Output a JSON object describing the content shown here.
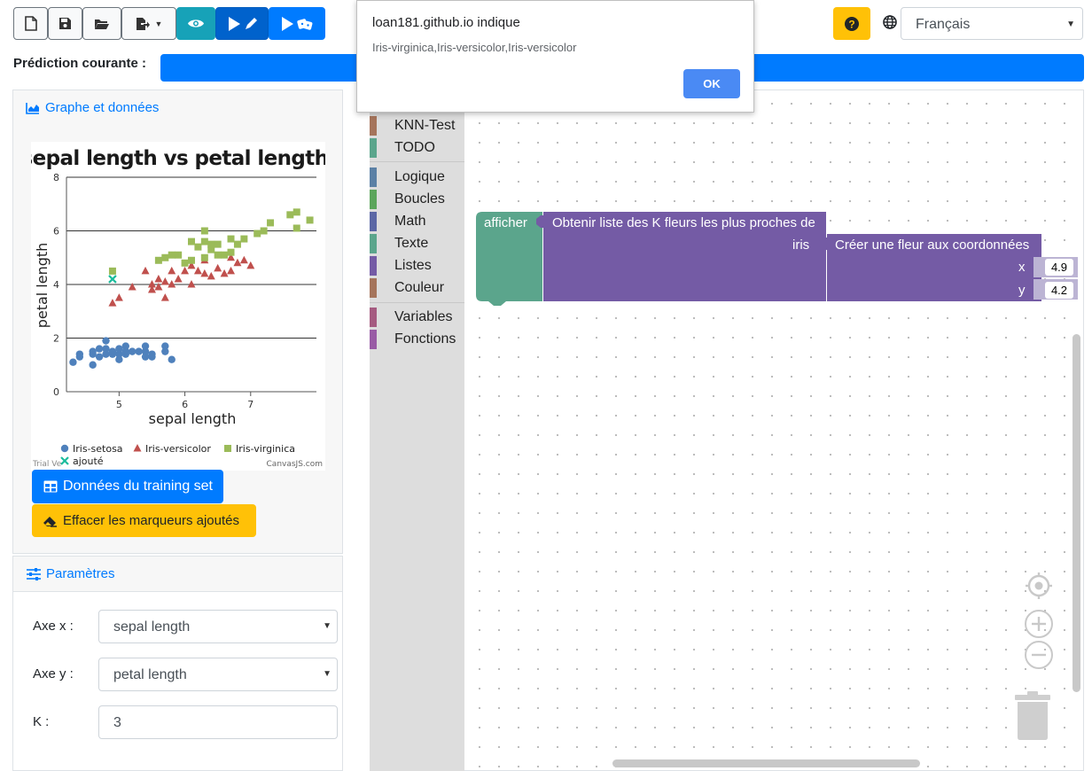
{
  "toolbar": {
    "buttons": [
      "new-file-icon",
      "save-icon",
      "open-folder-icon",
      "export-icon",
      "preview-eye-icon",
      "run-edit-icon",
      "run-random-icon"
    ],
    "help_icon": "question-icon",
    "language": {
      "selected": "Français",
      "icon": "globe-icon"
    }
  },
  "prediction": {
    "label": "Prédiction courante :"
  },
  "graph_card": {
    "header": "Graphe et données",
    "training_button": "Données du training set",
    "clear_button": "Effacer les marqueurs ajoutés"
  },
  "chart_data": {
    "type": "scatter",
    "title": "sepal length vs petal length",
    "xlabel": "sepal length",
    "ylabel": "petal length",
    "xlim": [
      4.2,
      8.0
    ],
    "ylim": [
      0,
      8
    ],
    "x_ticks": [
      5,
      6,
      7
    ],
    "y_ticks": [
      0,
      2,
      4,
      6,
      8
    ],
    "grid": true,
    "legend_position": "bottom",
    "watermark_left": "Trial Ve",
    "credit": "CanvasJS.com",
    "series": [
      {
        "name": "Iris-setosa",
        "marker": "circle",
        "color": "#4f81bc",
        "points": [
          [
            4.3,
            1.1
          ],
          [
            4.4,
            1.3
          ],
          [
            4.4,
            1.4
          ],
          [
            4.6,
            1.0
          ],
          [
            4.6,
            1.4
          ],
          [
            4.6,
            1.5
          ],
          [
            4.7,
            1.3
          ],
          [
            4.7,
            1.6
          ],
          [
            4.8,
            1.4
          ],
          [
            4.8,
            1.6
          ],
          [
            4.8,
            1.9
          ],
          [
            4.9,
            1.4
          ],
          [
            4.9,
            1.5
          ],
          [
            5.0,
            1.2
          ],
          [
            5.0,
            1.4
          ],
          [
            5.0,
            1.6
          ],
          [
            5.1,
            1.4
          ],
          [
            5.1,
            1.5
          ],
          [
            5.1,
            1.7
          ],
          [
            5.2,
            1.5
          ],
          [
            5.3,
            1.5
          ],
          [
            5.4,
            1.3
          ],
          [
            5.4,
            1.5
          ],
          [
            5.4,
            1.7
          ],
          [
            5.5,
            1.3
          ],
          [
            5.5,
            1.4
          ],
          [
            5.7,
            1.5
          ],
          [
            5.7,
            1.7
          ],
          [
            5.8,
            1.2
          ]
        ]
      },
      {
        "name": "Iris-versicolor",
        "marker": "triangle",
        "color": "#c0504d",
        "points": [
          [
            4.9,
            3.3
          ],
          [
            5.0,
            3.5
          ],
          [
            5.2,
            3.9
          ],
          [
            5.4,
            4.5
          ],
          [
            5.5,
            3.8
          ],
          [
            5.5,
            4.0
          ],
          [
            5.6,
            3.9
          ],
          [
            5.6,
            4.2
          ],
          [
            5.7,
            3.5
          ],
          [
            5.7,
            4.1
          ],
          [
            5.8,
            4.0
          ],
          [
            5.8,
            4.5
          ],
          [
            5.9,
            4.2
          ],
          [
            6.0,
            4.5
          ],
          [
            6.1,
            4.0
          ],
          [
            6.1,
            4.7
          ],
          [
            6.2,
            4.5
          ],
          [
            6.3,
            4.4
          ],
          [
            6.3,
            4.9
          ],
          [
            6.4,
            4.3
          ],
          [
            6.5,
            4.6
          ],
          [
            6.6,
            4.4
          ],
          [
            6.7,
            4.5
          ],
          [
            6.7,
            5.0
          ],
          [
            6.8,
            4.8
          ],
          [
            6.9,
            4.9
          ],
          [
            7.0,
            4.7
          ]
        ]
      },
      {
        "name": "Iris-virginica",
        "marker": "square",
        "color": "#9bbb59",
        "points": [
          [
            4.9,
            4.5
          ],
          [
            5.6,
            4.9
          ],
          [
            5.7,
            5.0
          ],
          [
            5.8,
            5.1
          ],
          [
            5.9,
            5.1
          ],
          [
            6.0,
            4.8
          ],
          [
            6.1,
            4.9
          ],
          [
            6.1,
            5.6
          ],
          [
            6.2,
            5.4
          ],
          [
            6.3,
            5.0
          ],
          [
            6.3,
            5.6
          ],
          [
            6.3,
            6.0
          ],
          [
            6.4,
            5.3
          ],
          [
            6.4,
            5.5
          ],
          [
            6.5,
            5.1
          ],
          [
            6.5,
            5.5
          ],
          [
            6.6,
            5.1
          ],
          [
            6.7,
            5.2
          ],
          [
            6.7,
            5.7
          ],
          [
            6.8,
            5.5
          ],
          [
            6.9,
            5.7
          ],
          [
            7.1,
            5.9
          ],
          [
            7.2,
            6.0
          ],
          [
            7.3,
            6.3
          ],
          [
            7.6,
            6.6
          ],
          [
            7.7,
            6.7
          ],
          [
            7.7,
            6.1
          ],
          [
            7.9,
            6.4
          ]
        ]
      },
      {
        "name": "ajouté",
        "marker": "cross",
        "color": "#1abc9c",
        "points": [
          [
            4.9,
            4.2
          ]
        ]
      }
    ]
  },
  "params": {
    "header": "Paramètres",
    "axis_x_label": "Axe x :",
    "axis_x_value": "sepal length",
    "axis_y_label": "Axe y :",
    "axis_y_value": "petal length",
    "k_label": "K :",
    "k_value": "3"
  },
  "toolbox": {
    "categories": [
      {
        "label": "KNN-Test",
        "color": "#a5745b"
      },
      {
        "label": "TODO",
        "color": "#5ba58c"
      },
      {
        "label": "Logique",
        "color": "#5b80a5"
      },
      {
        "label": "Boucles",
        "color": "#5ba55b"
      },
      {
        "label": "Math",
        "color": "#5b67a5"
      },
      {
        "label": "Texte",
        "color": "#5ba58c"
      },
      {
        "label": "Listes",
        "color": "#745ba5"
      },
      {
        "label": "Couleur",
        "color": "#a5745b"
      },
      {
        "label": "Variables",
        "color": "#a55b80"
      },
      {
        "label": "Fonctions",
        "color": "#995ba5"
      }
    ]
  },
  "blocks": {
    "print_label": "afficher",
    "knn_label": "Obtenir liste des K fleurs les plus proches de",
    "iris_label": "iris",
    "create_label": "Créer une fleur aux coordonnées",
    "x_label": "x",
    "x_value": "4.9",
    "y_label": "y",
    "y_value": "4.2",
    "print_color": "#5ba58c",
    "knn_color": "#745ba5"
  },
  "dialog": {
    "title": "loan181.github.io indique",
    "message": "Iris-virginica,Iris-versicolor,Iris-versicolor",
    "ok_label": "OK"
  },
  "workspace_controls": [
    "recenter-icon",
    "zoom-in-icon",
    "zoom-out-icon",
    "trash-icon"
  ]
}
